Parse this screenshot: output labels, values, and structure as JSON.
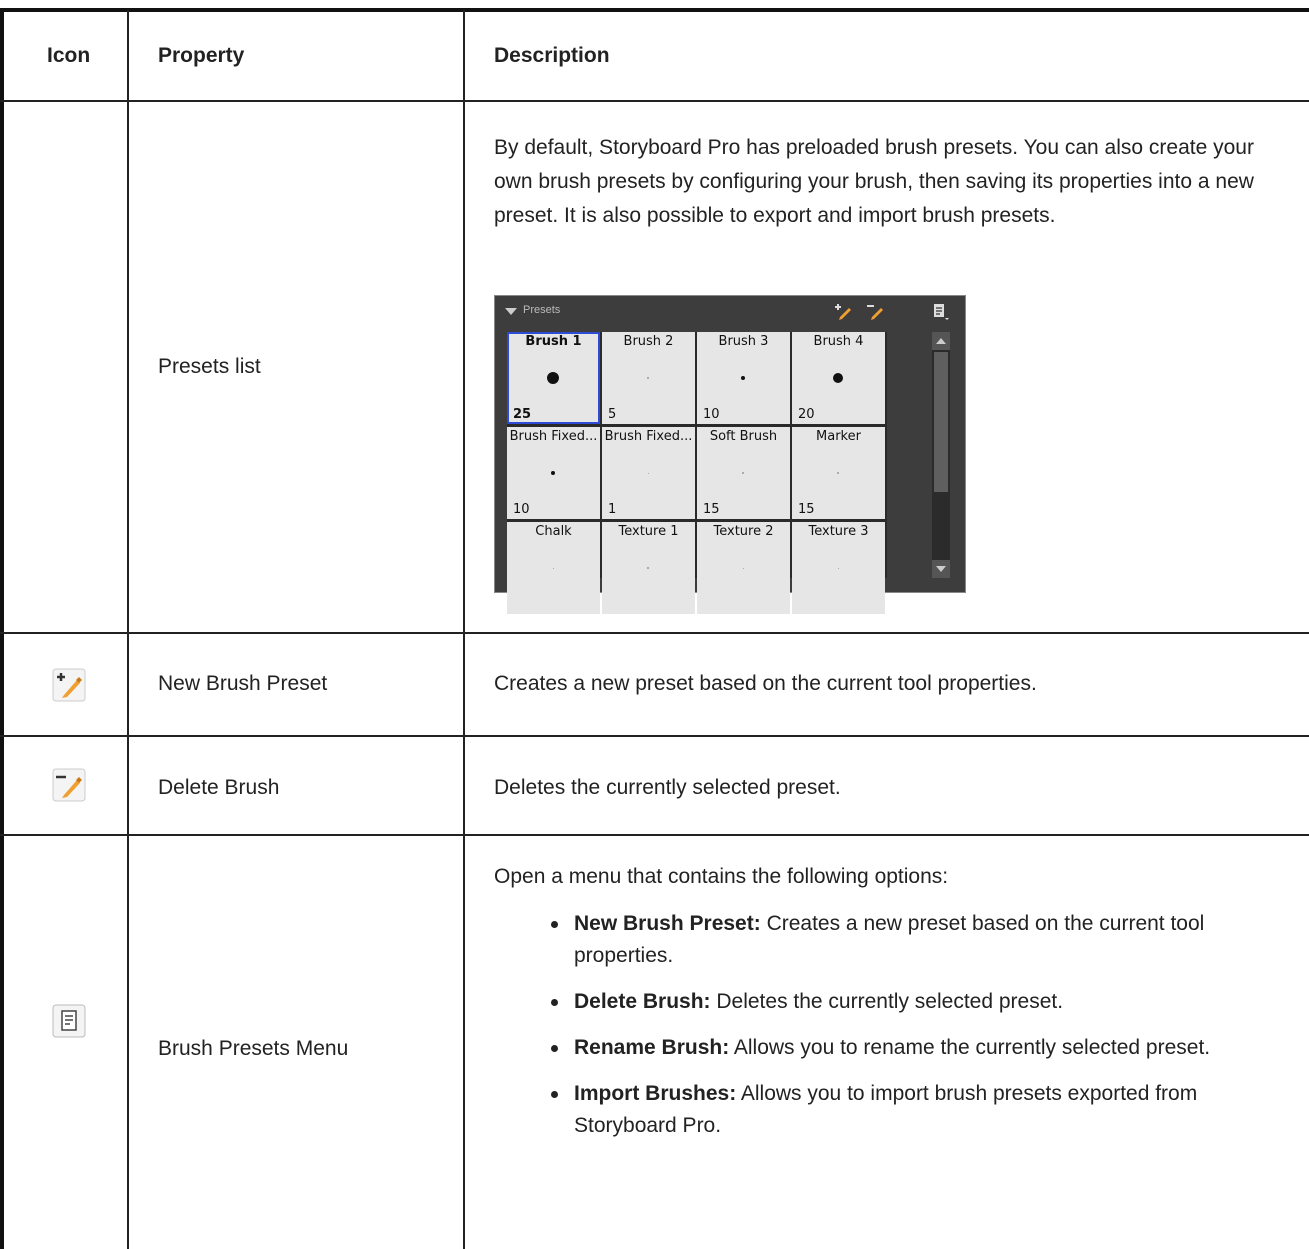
{
  "headers": {
    "icon": "Icon",
    "property": "Property",
    "description": "Description"
  },
  "rows": [
    {
      "property": "Presets list",
      "description": "By default, Storyboard Pro has preloaded brush presets. You can also create your own brush presets by configuring your brush, then saving its properties into a new preset. It is also possible to export and import brush presets."
    },
    {
      "icon": "new-brush-preset-icon",
      "property": "New Brush Preset",
      "description": "Creates a new preset based on the current tool properties."
    },
    {
      "icon": "delete-brush-icon",
      "property": "Delete Brush",
      "description": "Deletes the currently selected preset."
    },
    {
      "icon": "brush-presets-menu-icon",
      "property": "Brush Presets Menu",
      "description": "Open a menu that contains the following options:",
      "options": [
        {
          "label": "New Brush Preset:",
          "text": " Creates a new preset based on the current tool properties."
        },
        {
          "label": "Delete Brush:",
          "text": " Deletes the currently selected preset."
        },
        {
          "label": "Rename Brush:",
          "text": " Allows you to rename the currently selected preset."
        },
        {
          "label": "Import Brushes:",
          "text": " Allows you to import brush presets exported from Storyboard Pro."
        }
      ]
    }
  ],
  "presets_panel": {
    "title": "Presets",
    "selected": "Brush 1",
    "tiles": [
      {
        "name": "Brush 1",
        "size": "25"
      },
      {
        "name": "Brush 2",
        "size": "5"
      },
      {
        "name": "Brush 3",
        "size": "10"
      },
      {
        "name": "Brush 4",
        "size": "20"
      },
      {
        "name": "Brush Fixed...",
        "size": "10"
      },
      {
        "name": "Brush Fixed...",
        "size": "1"
      },
      {
        "name": "Soft Brush",
        "size": "15"
      },
      {
        "name": "Marker",
        "size": "15"
      },
      {
        "name": "Chalk",
        "size": ""
      },
      {
        "name": "Texture 1",
        "size": ""
      },
      {
        "name": "Texture 2",
        "size": ""
      },
      {
        "name": "Texture 3",
        "size": ""
      }
    ]
  },
  "colors": {
    "accent_pencil": "#f0a030",
    "selection_blue": "#2e4bd6",
    "panel_bg": "#3d3d3d"
  }
}
